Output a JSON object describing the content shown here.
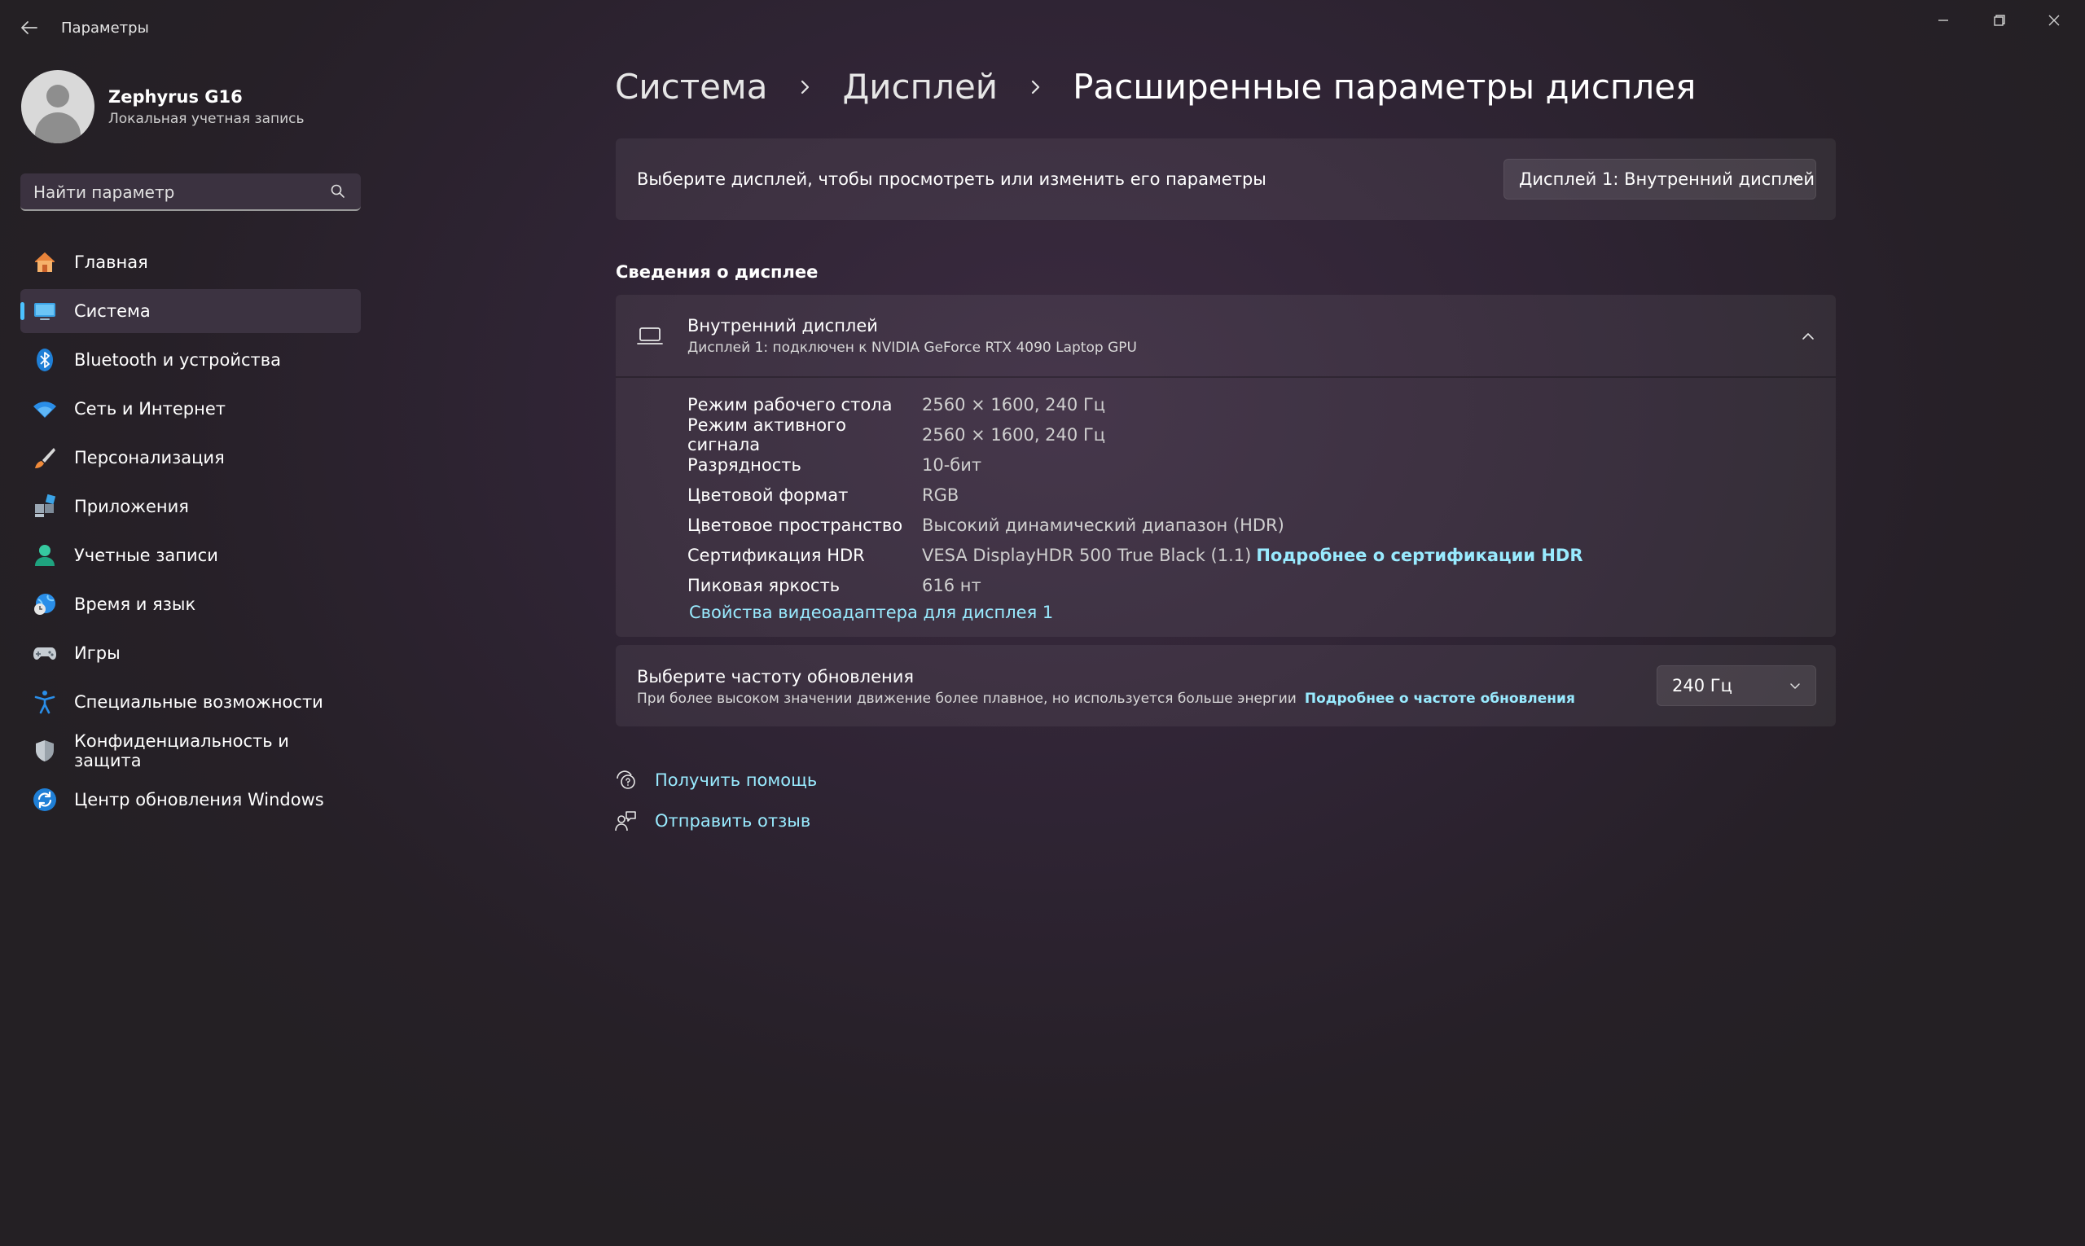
{
  "app": {
    "title": "Параметры"
  },
  "profile": {
    "name": "Zephyrus G16",
    "account_type": "Локальная учетная запись"
  },
  "search": {
    "placeholder": "Найти параметр"
  },
  "sidebar": {
    "items": [
      {
        "label": "Главная",
        "icon": "home-icon"
      },
      {
        "label": "Система",
        "icon": "system-display-icon",
        "selected": true
      },
      {
        "label": "Bluetooth и устройства",
        "icon": "bluetooth-icon"
      },
      {
        "label": "Сеть и Интернет",
        "icon": "wifi-icon"
      },
      {
        "label": "Персонализация",
        "icon": "brush-icon"
      },
      {
        "label": "Приложения",
        "icon": "apps-icon"
      },
      {
        "label": "Учетные записи",
        "icon": "account-icon"
      },
      {
        "label": "Время и язык",
        "icon": "time-language-icon"
      },
      {
        "label": "Игры",
        "icon": "gamepad-icon"
      },
      {
        "label": "Специальные возможности",
        "icon": "accessibility-icon"
      },
      {
        "label": "Конфиденциальность и защита",
        "icon": "shield-icon"
      },
      {
        "label": "Центр обновления Windows",
        "icon": "update-icon"
      }
    ]
  },
  "breadcrumb": [
    "Система",
    "Дисплей",
    "Расширенные параметры дисплея"
  ],
  "display_select": {
    "text": "Выберите дисплей, чтобы просмотреть или изменить его параметры",
    "value": "Дисплей 1: Внутренний дисплей"
  },
  "display_info": {
    "section_title": "Сведения о дисплее",
    "title": "Внутренний дисплей",
    "subtitle": "Дисплей 1: подключен к NVIDIA GeForce RTX 4090 Laptop GPU",
    "rows": [
      {
        "label": "Режим рабочего стола",
        "value": "2560 × 1600, 240 Гц"
      },
      {
        "label": "Режим активного сигнала",
        "value": "2560 × 1600, 240 Гц"
      },
      {
        "label": "Разрядность",
        "value": "10-бит"
      },
      {
        "label": "Цветовой формат",
        "value": "RGB"
      },
      {
        "label": "Цветовое пространство",
        "value": "Высокий динамический диапазон (HDR)"
      },
      {
        "label": "Сертификация HDR",
        "value": "VESA DisplayHDR 500 True Black (1.1)",
        "link": "Подробнее о сертификации HDR"
      },
      {
        "label": "Пиковая яркость",
        "value": "616 нт"
      }
    ],
    "adapter_link": "Свойства видеоадаптера для дисплея 1"
  },
  "refresh_rate": {
    "title": "Выберите частоту обновления",
    "description": "При более высоком значении движение более плавное, но используется больше энергии",
    "link": "Подробнее о частоте обновления",
    "value": "240 Гц"
  },
  "help": {
    "get_help": "Получить помощь",
    "send_feedback": "Отправить отзыв"
  },
  "colors": {
    "accent": "#4cc2ff",
    "link": "#99ebff"
  }
}
